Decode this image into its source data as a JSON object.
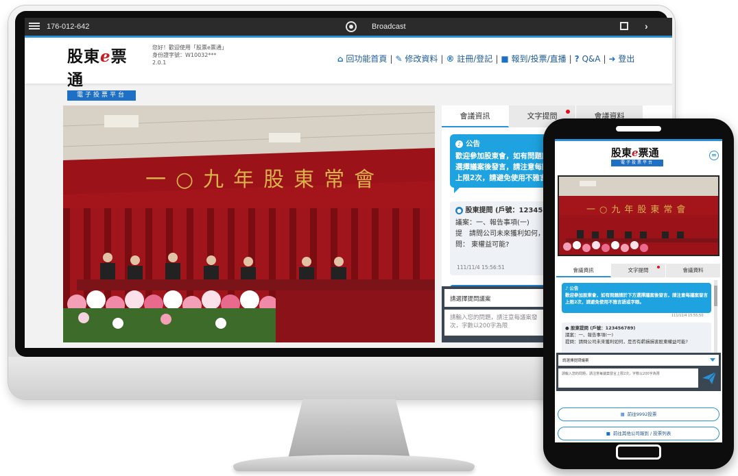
{
  "topbar": {
    "phone_number": "176-012-642",
    "broadcast_label": "Broadcast"
  },
  "brand": {
    "logo_prefix": "股東",
    "logo_e": "e",
    "logo_suffix": "票通",
    "logo_sub": "電子投票平台"
  },
  "welcome": {
    "line1": "您好！歡迎使用「股票e票通」",
    "line2": "身份證字號：W10032***",
    "line3": "2.0.1"
  },
  "nav": {
    "items": [
      {
        "icon": "home-icon",
        "glyph": "⌂",
        "label": "回功能首頁"
      },
      {
        "icon": "edit-icon",
        "glyph": "✎",
        "label": "修改資料"
      },
      {
        "icon": "register-icon",
        "glyph": "®",
        "label": "註冊/登記"
      },
      {
        "icon": "vote-icon",
        "glyph": "■",
        "label": "報到/投票/直播"
      },
      {
        "icon": "help-icon",
        "glyph": "?",
        "label": "Q&A"
      },
      {
        "icon": "logout-icon",
        "glyph": "➜",
        "label": "登出"
      }
    ]
  },
  "stage": {
    "banner_text": "一○九年股東常會"
  },
  "panel": {
    "tabs": [
      {
        "label": "會議資訊",
        "active": true,
        "dot": false
      },
      {
        "label": "文字提問",
        "active": false,
        "dot": true
      },
      {
        "label": "會議資料",
        "active": false,
        "dot": false
      }
    ],
    "notice_title": "公告",
    "notice_body": "歡迎參加股東會，如有問題請於下方選擇議案後發言，請注意每議案發言上限2次，請避免使用不雅言語或字眼。",
    "notice_body_desktop": "歡迎參加股東會，如有問題請於下方選擇議案後發言，請注意每議案發言上限2次，請避免使用不雅言語或字眼。",
    "question_title": "股東提問 (戶號：123456789)",
    "question_title_desktop": "股東提問 (戶號：1234567",
    "question_item": "議案：一、報告事項(一)",
    "question_body_desktop": "提　請問公司未來獲利如何，",
    "question_tail_desktop": "問：  東權益可能?",
    "question_body_mobile": "提問：請問公司未來獲利如何，是否有虧損損害股東權益可能?",
    "question_time": "111/11/4 15:56:51",
    "notice_time": "111/11/4 15:55:50",
    "select_placeholder": "請選擇提問議案",
    "textarea_placeholder": "請輸入您的問題，請注意每議案發言上限2次，字數以200字為限",
    "textarea_desktop_line1": "請輸入您的問題，請注意每議案發",
    "textarea_desktop_line2": "次，字數以200字為限"
  },
  "mobile": {
    "vote_button": "前往9992投票",
    "other_button": "前往其他公司報到 / 投票列表"
  },
  "colors": {
    "accent": "#2a91d6",
    "notice_bg": "#1ea3e0",
    "brand_red": "#c61d23",
    "dark_bar": "#3a4753"
  }
}
